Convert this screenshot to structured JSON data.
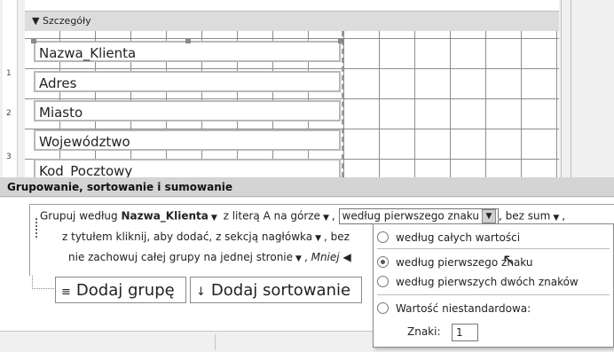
{
  "designer": {
    "section_label": "Szczegóły",
    "section_icon": "arrow-down-icon",
    "ruler_marks": [
      "1",
      "2",
      "3"
    ],
    "fields": [
      "Nazwa_Klienta",
      "Adres",
      "Miasto",
      "Województwo",
      "Kod_Pocztowy"
    ]
  },
  "group_panel": {
    "title": "Grupowanie, sortowanie i sumowanie",
    "line1": {
      "prefix": "Grupuj według",
      "field": "Nazwa_Klienta",
      "sort": "z literą A na górze",
      "group_on": "według pierwszego znaku",
      "totals": "bez sum"
    },
    "line2": {
      "title": "z tytułem kliknij, aby dodać",
      "header": "z sekcją nagłówka",
      "footer_prefix": "bez"
    },
    "line3": {
      "keep": "nie zachowuj całej grupy na jednej stronie",
      "less": "Mniej"
    },
    "add_group_button": "Dodaj grupę",
    "add_sort_button": "Dodaj sortowanie"
  },
  "dropdown": {
    "options": [
      {
        "label": "według całych wartości",
        "selected": false
      },
      {
        "label": "według pierwszego znaku",
        "selected": true
      },
      {
        "label": "według pierwszych dwóch znaków",
        "selected": false
      },
      {
        "label": "Wartość niestandardowa:",
        "selected": false
      }
    ],
    "chars_label": "Znaki:",
    "chars_value": "1"
  }
}
